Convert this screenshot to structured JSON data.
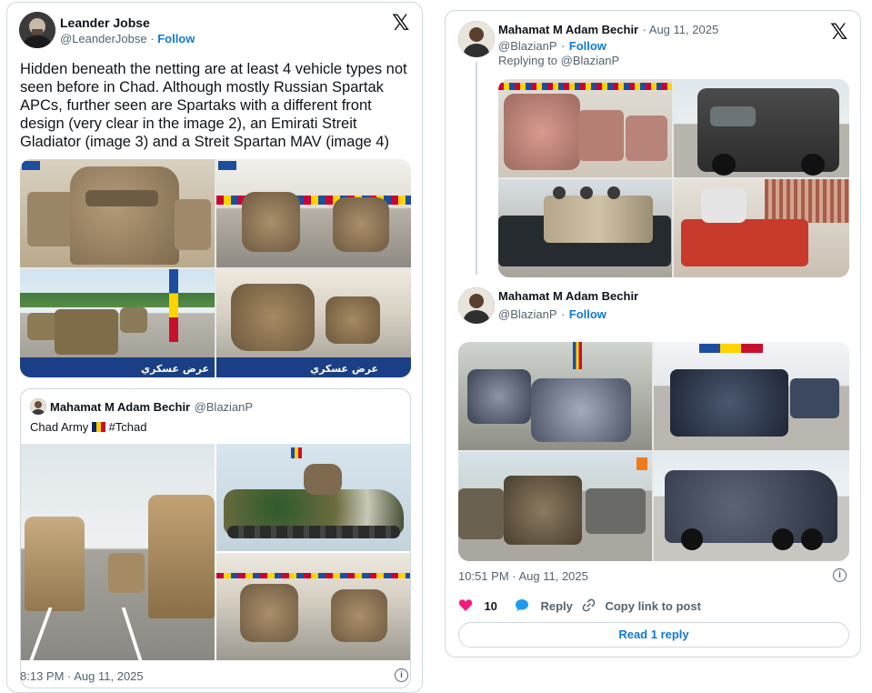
{
  "tweet_left": {
    "author_name": "Leander Jobse",
    "author_handle": "@LeanderJobse",
    "follow_label": "Follow",
    "dot": "·",
    "text": "Hidden beneath the netting are at least 4 vehicle types not seen before in Chad. Although mostly Russian Spartak APCs, further seen are Spartaks with a different front design (very clear in the image 2), an Emirati Streit Gladiator (image 3) and a Streit Spartan MAV (image 4)",
    "image_banners": [
      "عرض عسكري",
      "عرض عسكري"
    ],
    "quote": {
      "author_name": "Mahamat M Adam Bechir",
      "author_handle": "@BlazianP",
      "text": "Chad Army",
      "hashtag": "#Tchad"
    },
    "timestamp": "8:13 PM · Aug 11, 2025"
  },
  "tweet_right": {
    "author_name": "Mahamat M Adam Bechir",
    "dot_date": "· Aug 11, 2025",
    "author_handle": "@BlazianP",
    "follow_label": "Follow",
    "dot": "·",
    "replying_to": "Replying to @BlazianP",
    "second_author_name": "Mahamat M Adam Bechir",
    "second_author_handle": "@BlazianP",
    "second_follow_label": "Follow",
    "timestamp": "10:51 PM · Aug 11, 2025",
    "like_count": "10",
    "reply_label": "Reply",
    "copy_link_label": "Copy link to post",
    "read_reply_label": "Read 1 reply"
  },
  "colors": {
    "link": "#0f7ad8",
    "like": "#f91880",
    "border": "#cfd9de",
    "muted": "#536471"
  },
  "icons": [
    "x-logo-icon",
    "info-icon",
    "heart-icon",
    "reply-bubble-icon",
    "link-icon",
    "chad-flag-icon"
  ]
}
